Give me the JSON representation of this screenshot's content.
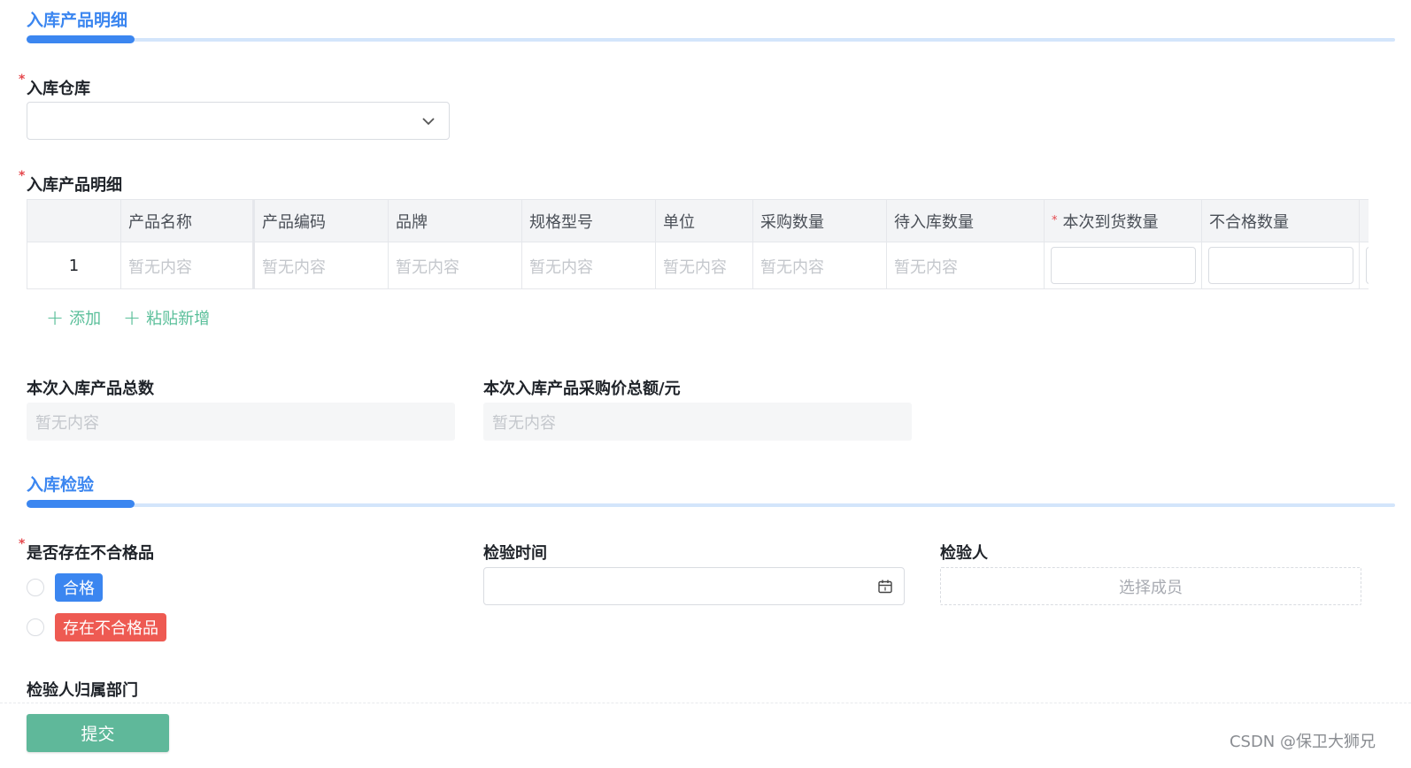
{
  "sections": {
    "product_detail_title": "入库产品明细",
    "inspection_title": "入库检验"
  },
  "warehouse": {
    "label": "入库仓库",
    "required_mark": "*",
    "value": ""
  },
  "product_table": {
    "label": "入库产品明细",
    "required_mark": "*",
    "columns": [
      "",
      "产品名称",
      "产品编码",
      "品牌",
      "规格型号",
      "单位",
      "采购数量",
      "待入库数量",
      "本次到货数量",
      "不合格数量"
    ],
    "arrival_required_mark": "*",
    "row": {
      "index": "1",
      "cells": [
        "暂无内容",
        "暂无内容",
        "暂无内容",
        "暂无内容",
        "暂无内容",
        "暂无内容",
        "暂无内容"
      ]
    }
  },
  "actions": {
    "add_label": "添加",
    "paste_add_label": "粘贴新增"
  },
  "totals": {
    "count_label": "本次入库产品总数",
    "count_value": "暂无内容",
    "amount_label": "本次入库产品采购价总额/元",
    "amount_value": "暂无内容"
  },
  "inspection": {
    "defect_label": "是否存在不合格品",
    "required_mark": "*",
    "option_pass": "合格",
    "option_fail": "存在不合格品",
    "time_label": "检验时间",
    "time_value": "",
    "inspector_label": "检验人",
    "inspector_placeholder": "选择成员",
    "department_label": "检验人归属部门"
  },
  "submit": {
    "label": "提交"
  },
  "watermark": "CSDN @保卫大狮兄",
  "colors": {
    "accent": "#3b86f0",
    "submit": "#5fb89a",
    "danger": "#ee5a52",
    "link": "#5abf9a"
  }
}
